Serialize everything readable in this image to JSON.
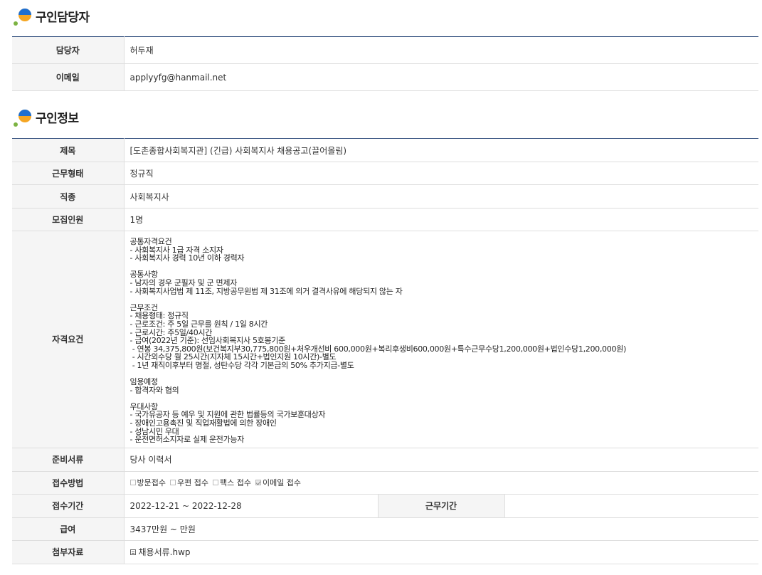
{
  "contact_section": {
    "title": "구인담당자",
    "rows": [
      {
        "label": "담당자",
        "value": "허두재"
      },
      {
        "label": "이메일",
        "value": "applyyfg@hanmail.net"
      }
    ]
  },
  "job_section": {
    "title": "구인정보",
    "job_title_label": "제목",
    "job_title": "[도촌종합사회복지관] (긴급) 사회복지사 채용공고(끌어올림)",
    "employment_type_label": "근무형태",
    "employment_type": "정규직",
    "occupation_label": "직종",
    "occupation": "사회복지사",
    "headcount_label": "모집인원",
    "headcount": "1명",
    "requirements_label": "자격요건",
    "requirements_lines": [
      "공통자격요건",
      "- 사회복지사 1급 자격 소지자",
      "- 사회복지사 경력 10년 이하 경력자",
      "",
      "공통사항",
      "- 남자의 경우 군필자 및 군 면제자",
      "- 사회복지사업법 제 11조, 지방공무원법 제 31조에 의거 결격사유에 해당되지 않는 자",
      "",
      "근무조건",
      "- 채용형태: 정규직",
      "- 근로조건: 주 5일 근무를 원칙 / 1일 8시간",
      "- 근로시간: 주5일/40시간",
      "- 급여(2022년 기준): 선임사회복지사 5호봉기준",
      " - 연봉 34,375,800원(보건복지부30,775,800원+처우개선비 600,000원+복리후생비600,000원+특수근무수당1,200,000원+법인수당1,200,000원)",
      " - 시간외수당 월 25시간(지자체 15시간+법인지원 10시간)-별도",
      " - 1년 재직이후부터 명절, 성탄수당 각각 기본급의 50% 추가지급-별도",
      "",
      "임용예정",
      "- 합격자와 협의",
      "",
      "우대사항",
      "- 국가유공자 등 예우 및 지원에 관한 법률등의 국가보훈대상자",
      "- 장애인고용촉진 및 직업재활법에 의한 장애인",
      "- 성남시민 우대",
      "- 운전면허소지자로 실제 운전가능자"
    ],
    "documents_label": "준비서류",
    "documents": "당사 이력서",
    "methods_label": "접수방법",
    "methods": [
      {
        "label": "방문접수",
        "checked": false
      },
      {
        "label": "우편 접수",
        "checked": false
      },
      {
        "label": "팩스 접수",
        "checked": false
      },
      {
        "label": "이메일 접수",
        "checked": true
      }
    ],
    "period_label": "접수기간",
    "period": "2022-12-21 ~ 2022-12-28",
    "work_period_label": "근무기간",
    "work_period": "",
    "salary_label": "급여",
    "salary": "3437만원 ~ 만원",
    "attachment_label": "첨부자료",
    "attachment": "채용서류.hwp"
  },
  "colors": {
    "header_border": "#2c4a7a",
    "label_bg": "#f5f5f5",
    "row_border": "#dedede",
    "logo_blue": "#1e6fd0",
    "logo_orange": "#f5a623",
    "logo_green": "#7cb342"
  }
}
